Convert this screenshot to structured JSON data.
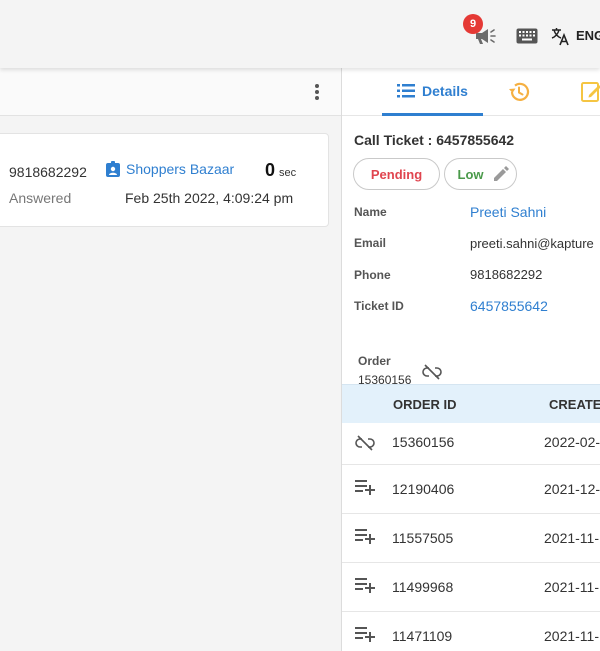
{
  "topbar": {
    "notification_count": "9",
    "megaphone_icon": "megaphone-icon",
    "keyboard_icon": "keyboard-icon",
    "translate_icon": "translate-icon",
    "language": "ENG"
  },
  "call": {
    "phone": "9818682292",
    "status": "Answered",
    "shop": "Shoppers Bazaar",
    "duration_value": "0",
    "duration_unit": "sec",
    "datetime": "Feb 25th 2022, 4:09:24 pm"
  },
  "tabs": {
    "details_label": "Details",
    "history_icon": "history-icon",
    "notes_icon": "notes-icon"
  },
  "ticket": {
    "title": "Call Ticket : 6457855642",
    "status_chip": "Pending",
    "priority_chip": "Low",
    "fields": [
      {
        "label": "Name",
        "value": "Preeti Sahni"
      },
      {
        "label": "Email",
        "value": "preeti.sahni@kapture"
      },
      {
        "label": "Phone",
        "value": "9818682292"
      },
      {
        "label": "Ticket ID",
        "value": "6457855642"
      }
    ]
  },
  "order": {
    "label": "Order",
    "value": "15360156"
  },
  "orders_table": {
    "headers": [
      "ORDER ID",
      "CREATE"
    ],
    "rows": [
      {
        "icon": "unlink-icon",
        "id": "15360156",
        "date": "2022-02-"
      },
      {
        "icon": "playlist-add-icon",
        "id": "12190406",
        "date": "2021-12-"
      },
      {
        "icon": "playlist-add-icon",
        "id": "11557505",
        "date": "2021-11-"
      },
      {
        "icon": "playlist-add-icon",
        "id": "11499968",
        "date": "2021-11-"
      },
      {
        "icon": "playlist-add-icon",
        "id": "11471109",
        "date": "2021-11-"
      }
    ]
  },
  "colors": {
    "accent": "#2f7fd0",
    "pending": "#e0454f",
    "low": "#4a9a4a",
    "badge": "#e53935",
    "history": "#f5b042",
    "notes": "#f5c542"
  }
}
